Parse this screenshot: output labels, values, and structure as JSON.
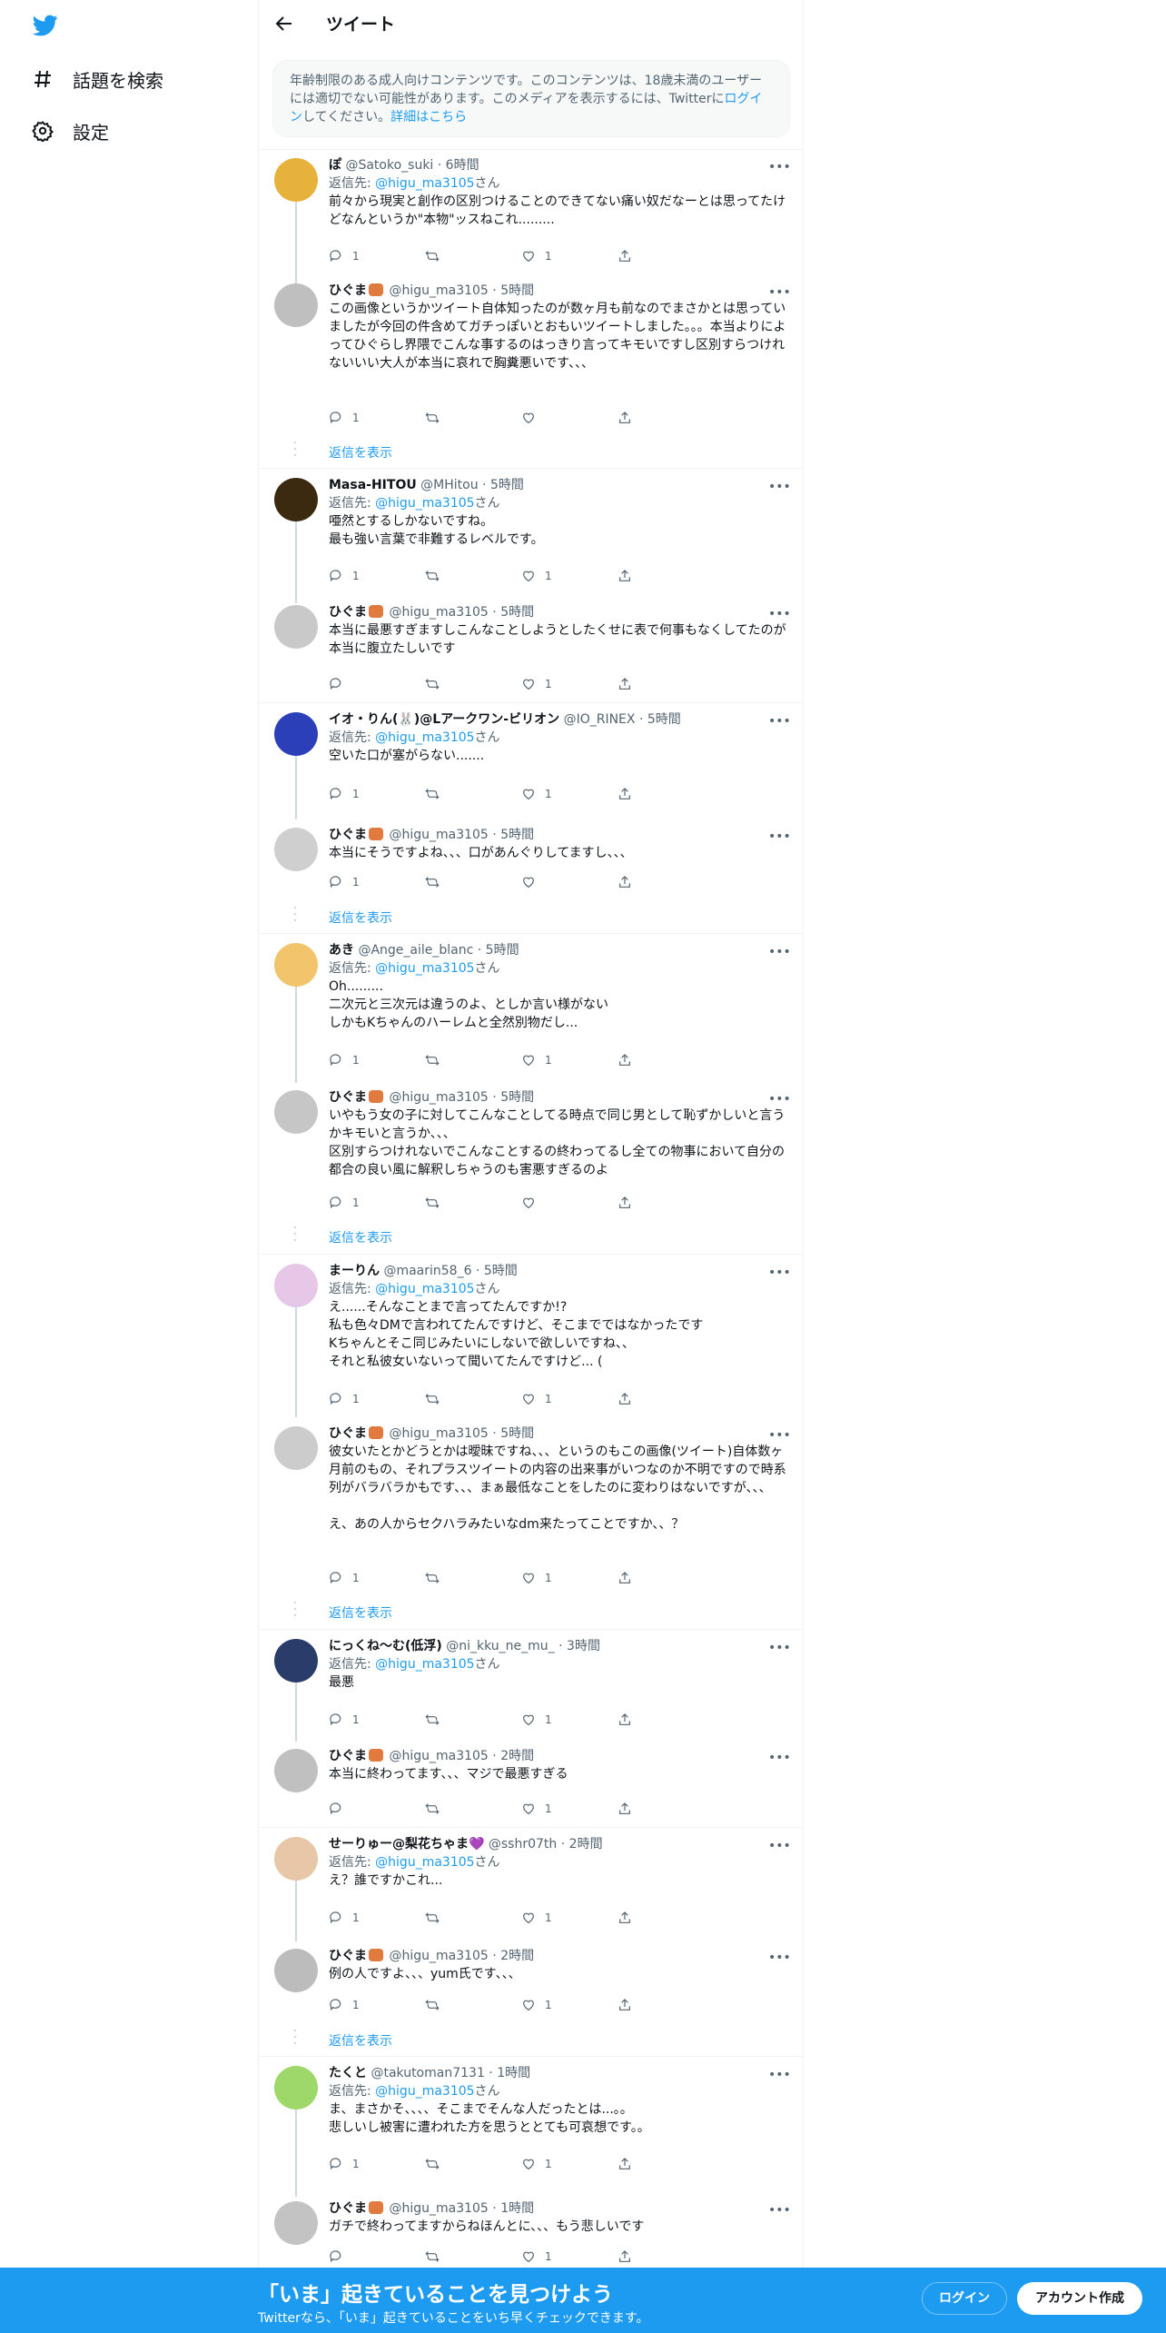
{
  "nav": {
    "logo": "twitter-bird-icon",
    "items": [
      {
        "label": "話題を検索",
        "icon": "hashtag-icon"
      },
      {
        "label": "設定",
        "icon": "gear-icon"
      }
    ]
  },
  "header": {
    "title": "ツイート"
  },
  "notice": {
    "text_before": "年齢制限のある成人向けコンテンツです。このコンテンツは、18歳未満のユーザーには適切でない可能性があります。このメディアを表示するには、Twitterに",
    "login_link": "ログイン",
    "text_after": "してください。",
    "details_link": "詳細はこちら"
  },
  "labels": {
    "reply_to": "返信先:",
    "san": "さん",
    "show_replies": "返信を表示"
  },
  "tweets": [
    {
      "name": "ぽ",
      "handle": "@Satoko_suki",
      "time": "6時間",
      "reply_to": "@higu_ma3105",
      "text": "前々から現実と創作の区別つけることのできてない痛い奴だなーとは思ってたけどなんというか\"本物\"ッスねこれ.........",
      "replies": "1",
      "retweets": "",
      "likes": "1"
    },
    {
      "name": "ひぐま",
      "handle": "@higu_ma3105",
      "time": "5時間",
      "text": "この画像というかツイート自体知ったのが数ヶ月も前なのでまさかとは思っていましたが今回の件含めてガチっぽいとおもいツイートしました。。。本当よりによってひぐらし界隈でこんな事するのはっきり言ってキモいですし区別すらつけれないいい大人が本当に哀れで胸糞悪いです、、、",
      "replies": "1",
      "retweets": "",
      "likes": ""
    },
    {
      "name": "Masa-HITOU",
      "handle": "@MHitou",
      "time": "5時間",
      "reply_to": "@higu_ma3105",
      "text": "唖然とするしかないですね。\n最も強い言葉で非難するレベルです。",
      "replies": "1",
      "retweets": "",
      "likes": "1"
    },
    {
      "name": "ひぐま",
      "handle": "@higu_ma3105",
      "time": "5時間",
      "text": "本当に最悪すぎますしこんなことしようとしたくせに表で何事もなくしてたのが本当に腹立たしいです",
      "replies": "",
      "retweets": "",
      "likes": "1"
    },
    {
      "name": "イオ・りん(🐰)@Lアークワン-ビリオン",
      "handle": "@IO_RINEX",
      "time": "5時間",
      "reply_to": "@higu_ma3105",
      "text": "空いた口が塞がらない.......",
      "replies": "1",
      "retweets": "",
      "likes": "1"
    },
    {
      "name": "ひぐま",
      "handle": "@higu_ma3105",
      "time": "5時間",
      "text": "本当にそうですよね、、、口があんぐりしてますし、、、",
      "replies": "1",
      "retweets": "",
      "likes": ""
    },
    {
      "name": "あき",
      "handle": "@Ange_aile_blanc",
      "time": "5時間",
      "reply_to": "@higu_ma3105",
      "text": "Oh.........\n二次元と三次元は違うのよ、としか言い様がない\nしかもKちゃんのハーレムと全然別物だし...",
      "replies": "1",
      "retweets": "",
      "likes": "1"
    },
    {
      "name": "ひぐま",
      "handle": "@higu_ma3105",
      "time": "5時間",
      "text": "いやもう女の子に対してこんなことしてる時点で同じ男として恥ずかしいと言うかキモいと言うか、、、\n区別すらつけれないでこんなことするの終わってるし全ての物事において自分の都合の良い風に解釈しちゃうのも害悪すぎるのよ",
      "replies": "1",
      "retweets": "",
      "likes": ""
    },
    {
      "name": "まーりん",
      "handle": "@maarin58_6",
      "time": "5時間",
      "reply_to": "@higu_ma3105",
      "text": "え......そんなことまで言ってたんですか!?\n私も色々DMで言われてたんですけど、そこまでではなかったです\nKちゃんとそこ同じみたいにしないで欲しいですね、、\nそれと私彼女いないって聞いてたんですけど... (",
      "replies": "1",
      "retweets": "",
      "likes": "1"
    },
    {
      "name": "ひぐま",
      "handle": "@higu_ma3105",
      "time": "5時間",
      "text": "彼女いたとかどうとかは曖昧ですね、、、というのもこの画像(ツイート)自体数ヶ月前のもの、それプラスツイートの内容の出来事がいつなのか不明ですので時系列がバラバラかもです、、、まぁ最低なことをしたのに変わりはないですが、、、\n\nえ、あの人からセクハラみたいなdm来たってことですか、、？",
      "replies": "1",
      "retweets": "",
      "likes": "1"
    },
    {
      "name": "にっくね〜む(低浮)",
      "handle": "@ni_kku_ne_mu_",
      "time": "3時間",
      "reply_to": "@higu_ma3105",
      "text": "最悪",
      "replies": "1",
      "retweets": "",
      "likes": "1"
    },
    {
      "name": "ひぐま",
      "handle": "@higu_ma3105",
      "time": "2時間",
      "text": "本当に終わってます、、、マジで最悪すぎる",
      "replies": "",
      "retweets": "",
      "likes": "1"
    },
    {
      "name": "せーりゅー@梨花ちゃま💜",
      "handle": "@sshr07th",
      "time": "2時間",
      "reply_to": "@higu_ma3105",
      "text": "え？誰ですかこれ...",
      "replies": "1",
      "retweets": "",
      "likes": "1"
    },
    {
      "name": "ひぐま",
      "handle": "@higu_ma3105",
      "time": "2時間",
      "text": "例の人ですよ、、、yum氏です、、、",
      "replies": "1",
      "retweets": "",
      "likes": "1"
    },
    {
      "name": "たくと",
      "handle": "@takutoman7131",
      "time": "1時間",
      "reply_to": "@higu_ma3105",
      "text": "ま、まさかそ、、、、そこまでそんな人だったとは...。。\n悲しいし被害に遭われた方を思うととても可哀想です。。",
      "replies": "1",
      "retweets": "",
      "likes": "1"
    },
    {
      "name": "ひぐま",
      "handle": "@higu_ma3105",
      "time": "1時間",
      "text": "ガチで終わってますからねほんとに、、、もう悲しいです",
      "replies": "",
      "retweets": "",
      "likes": "1"
    }
  ],
  "bottom_bar": {
    "title": "「いま」起きていることを見つけよう",
    "subtitle": "Twitterなら、「いま」起きていることをいち早くチェックできます。",
    "login": "ログイン",
    "signup": "アカウント作成"
  },
  "colors": {
    "accent": "#1d9bf0",
    "text": "#0f1419",
    "secondary": "#536471"
  }
}
